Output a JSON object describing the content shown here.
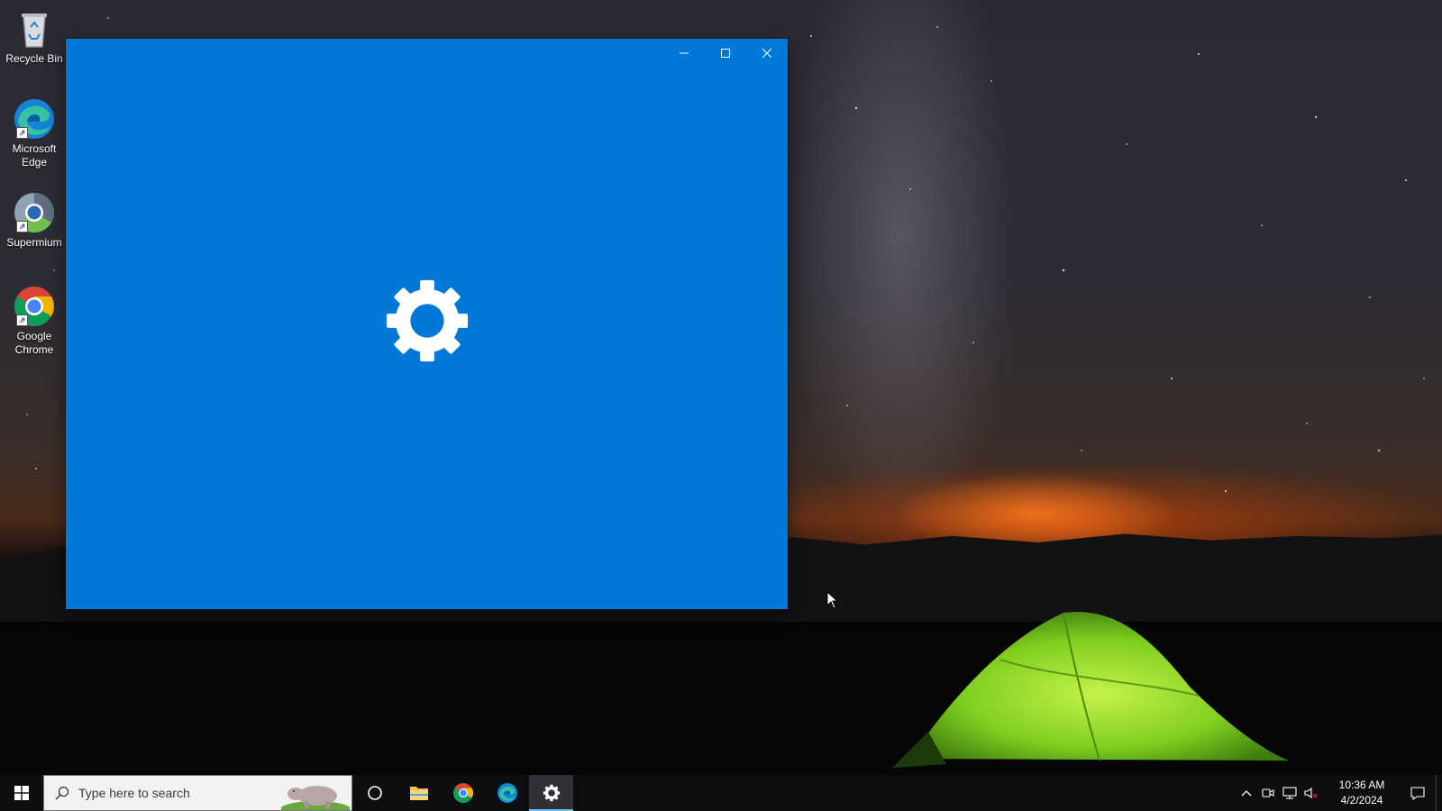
{
  "desktop": {
    "icons": [
      {
        "label": "Recycle Bin",
        "icon": "recycle-bin-icon"
      },
      {
        "label": "Microsoft Edge",
        "icon": "edge-icon"
      },
      {
        "label": "Supermium",
        "icon": "supermium-icon"
      },
      {
        "label": "Google Chrome",
        "icon": "chrome-icon"
      }
    ]
  },
  "window": {
    "app": "Settings",
    "splash_icon": "gear-icon",
    "background_color": "#0078d7",
    "controls": [
      "minimize-icon",
      "maximize-icon",
      "close-icon"
    ]
  },
  "taskbar": {
    "search_placeholder": "Type here to search",
    "apps": [
      "task-view-icon",
      "file-explorer-icon",
      "chrome-icon",
      "edge-icon",
      "settings-gear-icon"
    ],
    "active_app": "Settings",
    "clock": {
      "time": "10:36 AM",
      "date": "4/2/2024"
    },
    "tray_icons": [
      "chevron-up-icon",
      "meet-now-icon",
      "network-icon",
      "volume-muted-icon"
    ]
  }
}
